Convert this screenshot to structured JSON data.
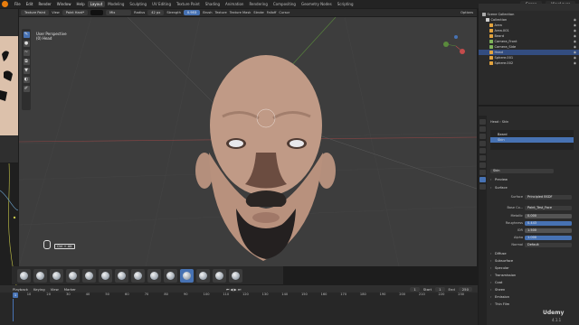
{
  "menu": {
    "items": [
      "File",
      "Edit",
      "Render",
      "Window",
      "Help"
    ],
    "workspaces": [
      "Layout",
      "Modeling",
      "Sculpting",
      "UV Editing",
      "Texture Paint",
      "Shading",
      "Animation",
      "Rendering",
      "Compositing",
      "Geometry Nodes",
      "Scripting"
    ],
    "active_workspace": "Layout",
    "scene": "Scene",
    "view_layer": "ViewLayer"
  },
  "editor_header": {
    "mode": "Texture Paint",
    "view": "View",
    "brush": "Paint Hard*",
    "blend": "Mix",
    "radius_label": "Radius",
    "radius_value": "42 px",
    "strength_label": "Strength",
    "strength_value": "0.953",
    "brush_menu": "Brush",
    "texture_menu": "Texture",
    "texture_mask_menu": "Texture Mask",
    "stroke_menu": "Stroke",
    "falloff_menu": "Falloff",
    "cursor_menu": "Cursor",
    "options": "Options"
  },
  "viewport": {
    "view_name": "User Perspective",
    "object_name": "(0) Head",
    "shortcut": "Ctrl + Alt",
    "colors": {
      "background": "#3d3d3d",
      "skin": "#c09a86"
    }
  },
  "outliner": {
    "title": "Scene Collection",
    "rows": [
      {
        "label": "Collection",
        "color": "#d0d0d0",
        "selected": false
      },
      {
        "label": "Area",
        "color": "#e2a33e",
        "selected": false
      },
      {
        "label": "Area.001",
        "color": "#e2a33e",
        "selected": false
      },
      {
        "label": "Beard",
        "color": "#e2a33e",
        "selected": false
      },
      {
        "label": "Camera_Front",
        "color": "#7fb35a",
        "selected": false
      },
      {
        "label": "Camera_Side",
        "color": "#7fb35a",
        "selected": false
      },
      {
        "label": "Head",
        "color": "#e2a33e",
        "selected": true
      },
      {
        "label": "Sphere.001",
        "color": "#e2a33e",
        "selected": false
      },
      {
        "label": "Sphere.002",
        "color": "#e2a33e",
        "selected": false
      }
    ]
  },
  "properties": {
    "object": "Head",
    "material_breadcrumb": "Skin",
    "slots": [
      "Beard",
      "Skin"
    ],
    "active_slot": "Skin",
    "material_name": "Skin",
    "sections": {
      "preview": "Preview",
      "surface": "Surface",
      "diffuse": "Diffuse",
      "subsurface": "Subsurface",
      "specular": "Specular",
      "transmission": "Transmission",
      "coat": "Coat",
      "sheen": "Sheen",
      "emission": "Emission",
      "thin_film": "Thin Film"
    },
    "surface_fields": [
      {
        "key": "Surface",
        "value": "Principled BSDF",
        "style": "dark"
      },
      {
        "key": "Base Co...",
        "value": "Paint_Test_Face",
        "style": "dark"
      },
      {
        "key": "Metallic",
        "value": "0.000",
        "style": ""
      },
      {
        "key": "Roughness",
        "value": "0.443",
        "style": "blue"
      },
      {
        "key": "IOR",
        "value": "1.500",
        "style": ""
      },
      {
        "key": "Alpha",
        "value": "1.000",
        "style": "blue"
      },
      {
        "key": "Normal",
        "value": "Default",
        "style": "dark"
      }
    ]
  },
  "timeline": {
    "menus": [
      "Playback",
      "Keying",
      "View",
      "Marker"
    ],
    "current_frame": "1",
    "start_label": "Start",
    "start": "1",
    "end_label": "End",
    "end": "250",
    "frame_ticks": [
      "10",
      "20",
      "30",
      "40",
      "50",
      "60",
      "70",
      "80",
      "90",
      "100",
      "110",
      "120",
      "130",
      "140",
      "150",
      "160",
      "170",
      "180",
      "190",
      "200",
      "210",
      "220",
      "230",
      "240",
      "250"
    ]
  },
  "status": {
    "version": "4.1.1",
    "watermark": "Udemy"
  }
}
